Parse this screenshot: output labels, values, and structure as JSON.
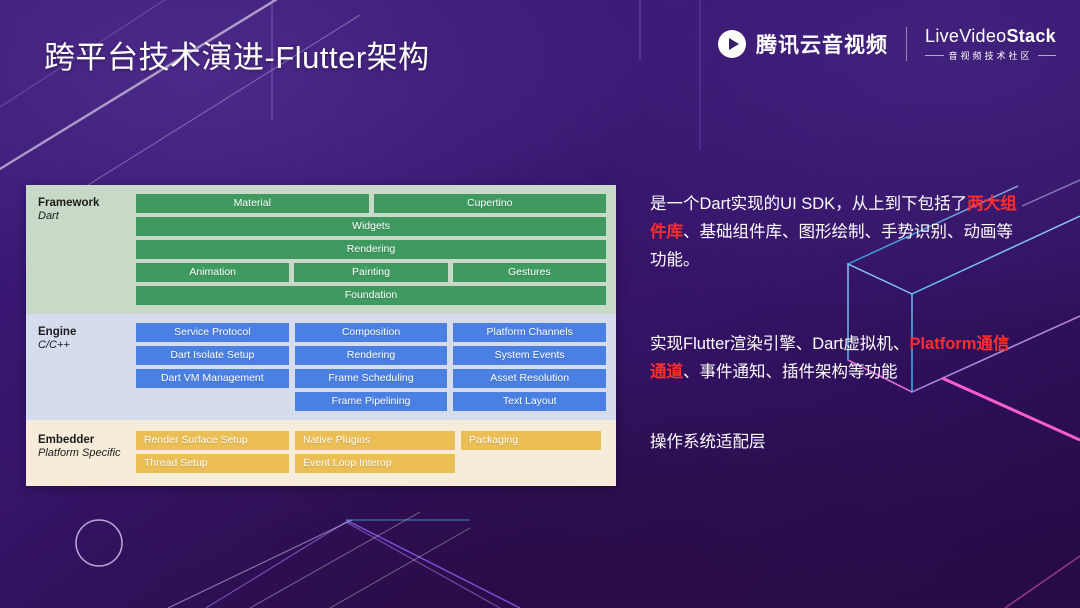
{
  "slide": {
    "title": "跨平台技术演进-Flutter架构",
    "background_color": "#3a1773"
  },
  "branding": {
    "tencent": {
      "icon": "play-triangle-icon",
      "text": "腾讯云音视频"
    },
    "livevideostack": {
      "main_prefix": "LiveVide",
      "main_o": "o",
      "main_suffix": "Stack",
      "main_full": "LiveVideoStack",
      "subtitle": "音视频技术社区"
    }
  },
  "diagram": {
    "sections": [
      {
        "id": "framework",
        "label_line1": "Framework",
        "label_line2": "Dart",
        "box_color": "#3f9a60",
        "panel_color": "#c8dac7",
        "rows": [
          [
            "Material",
            "Cupertino"
          ],
          [
            "Widgets"
          ],
          [
            "Rendering"
          ],
          [
            "Animation",
            "Painting",
            "Gestures"
          ],
          [
            "Foundation"
          ]
        ]
      },
      {
        "id": "engine",
        "label_line1": "Engine",
        "label_line2": "C/C++",
        "box_color": "#4a80e2",
        "panel_color": "#d5dced",
        "columns": [
          [
            "Service Protocol",
            "Dart Isolate Setup",
            "Dart VM Management"
          ],
          [
            "Composition",
            "Rendering",
            "Frame Scheduling",
            "Frame Pipelining"
          ],
          [
            "Platform Channels",
            "System Events",
            "Asset Resolution",
            "Text Layout"
          ]
        ]
      },
      {
        "id": "embedder",
        "label_line1": "Embedder",
        "label_line2": "Platform Specific",
        "box_color": "#ecbe56",
        "panel_color": "#f6ecd9",
        "rows": [
          [
            "Render Surface Setup",
            "Native Plugins",
            "Packaging"
          ],
          [
            "Thread Setup",
            "Event Loop Interop"
          ]
        ]
      }
    ]
  },
  "annotations": {
    "framework": {
      "part1": "是一个Dart实现的UI SDK，从上到下包括了",
      "highlight": "两大组件库",
      "part2": "、基础组件库、图形绘制、手势识别、动画等功能。",
      "highlight_color": "#ff2d2d"
    },
    "engine": {
      "part1": "实现Flutter渲染引擎、Dart虚拟机、",
      "highlight": "Platform通信通道",
      "part2": "、事件通知、插件架构等功能",
      "highlight_color": "#ff2d2d"
    },
    "embedder": {
      "part1": "操作系统适配层",
      "highlight": "",
      "part2": ""
    }
  }
}
